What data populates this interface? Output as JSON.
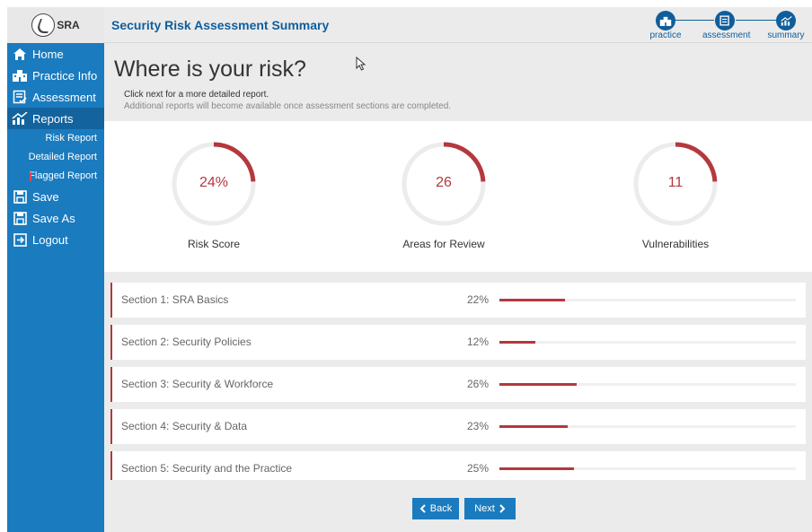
{
  "sidebar": {
    "logo_text": "SRA",
    "items": [
      {
        "label": "Home",
        "icon": "home-icon"
      },
      {
        "label": "Practice Info",
        "icon": "building-icon"
      },
      {
        "label": "Assessment",
        "icon": "checklist-icon"
      },
      {
        "label": "Reports",
        "icon": "chart-icon"
      },
      {
        "label": "Save",
        "icon": "save-icon"
      },
      {
        "label": "Save As",
        "icon": "save-as-icon"
      },
      {
        "label": "Logout",
        "icon": "logout-icon"
      }
    ],
    "report_subitems": [
      "Risk Report",
      "Detailed Report",
      "Flagged Report"
    ]
  },
  "header": {
    "title": "Security Risk Assessment Summary",
    "steps": [
      {
        "label": "practice",
        "icon": "building-icon"
      },
      {
        "label": "assessment",
        "icon": "checklist-icon"
      },
      {
        "label": "summary",
        "icon": "chart-icon"
      }
    ]
  },
  "intro": {
    "heading": "Where is your risk?",
    "line1": "Click next for a more detailed report.",
    "line2": "Additional reports will become available once assessment sections are completed."
  },
  "gauges": [
    {
      "value": "24%",
      "label": "Risk Score",
      "fill": 0.24
    },
    {
      "value": "26",
      "label": "Areas for Review",
      "fill": 0.24
    },
    {
      "value": "11",
      "label": "Vulnerabilities",
      "fill": 0.24
    }
  ],
  "sections": [
    {
      "name": "Section 1: SRA Basics",
      "pct": "22%",
      "fill": 0.22
    },
    {
      "name": "Section 2: Security Policies",
      "pct": "12%",
      "fill": 0.12
    },
    {
      "name": "Section 3: Security & Workforce",
      "pct": "26%",
      "fill": 0.26
    },
    {
      "name": "Section 4: Security & Data",
      "pct": "23%",
      "fill": 0.23
    },
    {
      "name": "Section 5: Security and the Practice",
      "pct": "25%",
      "fill": 0.25
    }
  ],
  "footer": {
    "back_label": "Back",
    "next_label": "Next"
  },
  "colors": {
    "accent": "#1a7bbf",
    "header_title": "#0f5e9c",
    "risk": "#b4383d",
    "panel": "#ebebeb"
  }
}
